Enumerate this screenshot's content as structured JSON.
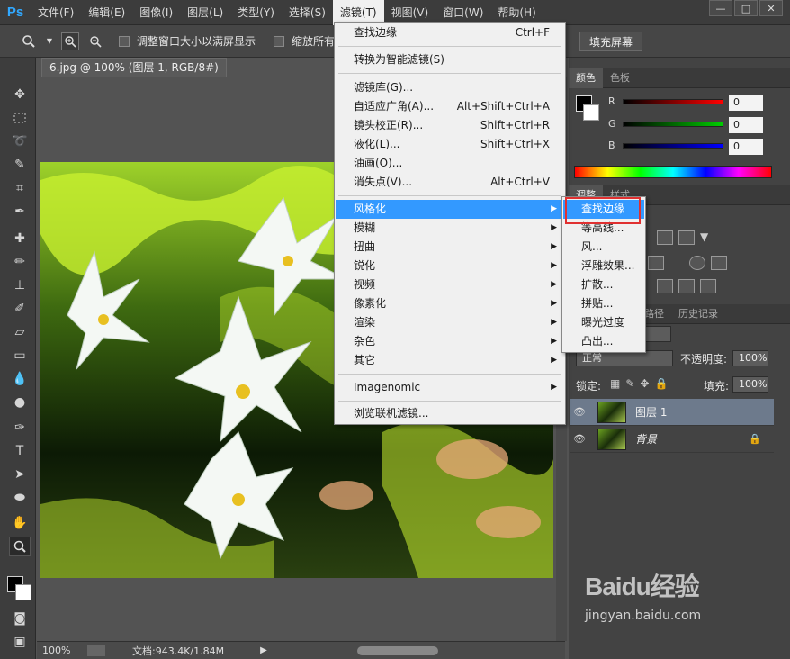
{
  "app": {
    "logo": "Ps"
  },
  "menubar": {
    "items": [
      "文件(F)",
      "编辑(E)",
      "图像(I)",
      "图层(L)",
      "类型(Y)",
      "选择(S)",
      "滤镜(T)",
      "视图(V)",
      "窗口(W)",
      "帮助(H)"
    ],
    "active_index": 6
  },
  "window_controls": {
    "minimize": "—",
    "restore": "□",
    "close": "✕"
  },
  "options": {
    "resize_label": "调整窗口大小以满屏显示",
    "zoom_all_label": "缩放所有",
    "fill_screen": "填充屏幕"
  },
  "document": {
    "tab_title": "6.jpg @ 100% (图层 1, RGB/8#) *",
    "tab_close": "✕",
    "zoom": "100%",
    "doc_info": "文档:943.4K/1.84M"
  },
  "filter_menu": {
    "items": [
      {
        "label": "查找边缘",
        "shortcut": "Ctrl+F"
      },
      {
        "label": "转换为智能滤镜(S)",
        "shortcut": ""
      },
      {
        "label": "滤镜库(G)...",
        "shortcut": ""
      },
      {
        "label": "自适应广角(A)...",
        "shortcut": "Alt+Shift+Ctrl+A"
      },
      {
        "label": "镜头校正(R)...",
        "shortcut": "Shift+Ctrl+R"
      },
      {
        "label": "液化(L)...",
        "shortcut": "Shift+Ctrl+X"
      },
      {
        "label": "油画(O)...",
        "shortcut": ""
      },
      {
        "label": "消失点(V)...",
        "shortcut": "Alt+Ctrl+V"
      },
      {
        "label": "风格化",
        "shortcut": ""
      },
      {
        "label": "模糊",
        "shortcut": ""
      },
      {
        "label": "扭曲",
        "shortcut": ""
      },
      {
        "label": "锐化",
        "shortcut": ""
      },
      {
        "label": "视频",
        "shortcut": ""
      },
      {
        "label": "像素化",
        "shortcut": ""
      },
      {
        "label": "渲染",
        "shortcut": ""
      },
      {
        "label": "杂色",
        "shortcut": ""
      },
      {
        "label": "其它",
        "shortcut": ""
      },
      {
        "label": "Imagenomic",
        "shortcut": ""
      },
      {
        "label": "浏览联机滤镜...",
        "shortcut": ""
      }
    ]
  },
  "stylize_submenu": {
    "items": [
      "查找边缘",
      "等高线...",
      "风...",
      "浮雕效果...",
      "扩散...",
      "拼贴...",
      "曝光过度",
      "凸出..."
    ]
  },
  "color_panel": {
    "tabs": [
      "颜色",
      "色板"
    ],
    "r_label": "R",
    "g_label": "G",
    "b_label": "B",
    "r_value": "0",
    "g_value": "0",
    "b_value": "0"
  },
  "adjust_panel": {
    "tabs": [
      "调整",
      "样式"
    ]
  },
  "layers_panel": {
    "tabs": [
      "图层",
      "通道",
      "路径",
      "历史记录"
    ],
    "blend_mode": "正常",
    "opacity_label": "不透明度:",
    "opacity_value": "100%",
    "lock_label": "锁定:",
    "fill_label": "填充:",
    "fill_value": "100%",
    "layers": [
      {
        "name": "图层 1"
      },
      {
        "name": "背景"
      }
    ]
  },
  "watermark": {
    "main": "Baidu经验",
    "sub": "jingyan.baidu.com"
  },
  "colors": {
    "highlight": "#3399ff",
    "red_box": "#e03030"
  }
}
